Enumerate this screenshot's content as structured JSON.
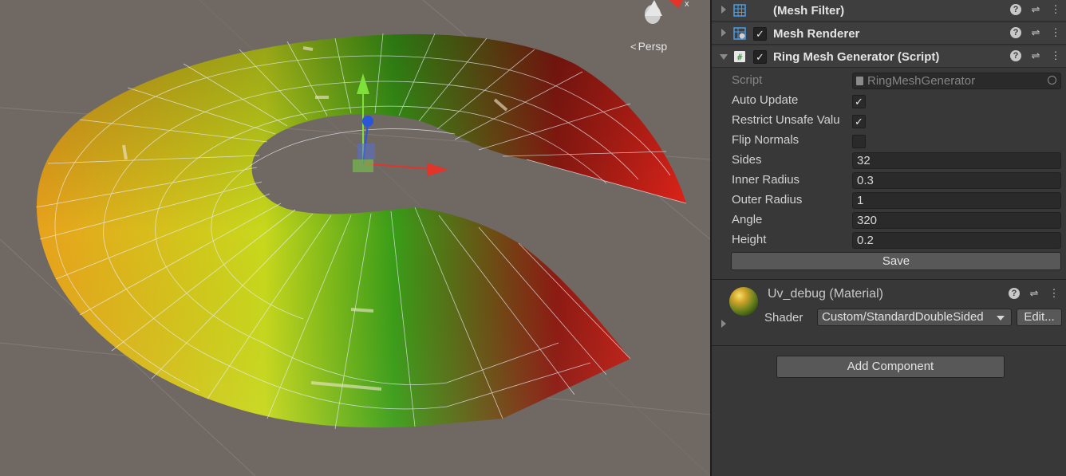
{
  "scene": {
    "projection_label": "Persp",
    "axis_label": "x"
  },
  "inspector": {
    "components": [
      {
        "title": "(Mesh Filter)",
        "icon": "mesh-filter-icon",
        "has_toggle": false
      },
      {
        "title": "Mesh Renderer",
        "icon": "mesh-renderer-icon",
        "has_toggle": true,
        "enabled": true
      },
      {
        "title": "Ring Mesh Generator (Script)",
        "icon": "script-icon",
        "has_toggle": true,
        "enabled": true,
        "expanded": true
      }
    ],
    "script": {
      "script_label": "Script",
      "script_value": "RingMeshGenerator",
      "auto_update_label": "Auto Update",
      "auto_update": true,
      "restrict_label": "Restrict Unsafe Valu",
      "restrict": true,
      "flip_normals_label": "Flip Normals",
      "flip_normals": false,
      "sides_label": "Sides",
      "sides": "32",
      "inner_radius_label": "Inner Radius",
      "inner_radius": "0.3",
      "outer_radius_label": "Outer Radius",
      "outer_radius": "1",
      "angle_label": "Angle",
      "angle": "320",
      "height_label": "Height",
      "height": "0.2",
      "save_label": "Save"
    },
    "material": {
      "title": "Uv_debug (Material)",
      "shader_label": "Shader",
      "shader_value": "Custom/StandardDoubleSided",
      "edit_label": "Edit..."
    },
    "add_component_label": "Add Component",
    "check_glyph": "✓"
  }
}
